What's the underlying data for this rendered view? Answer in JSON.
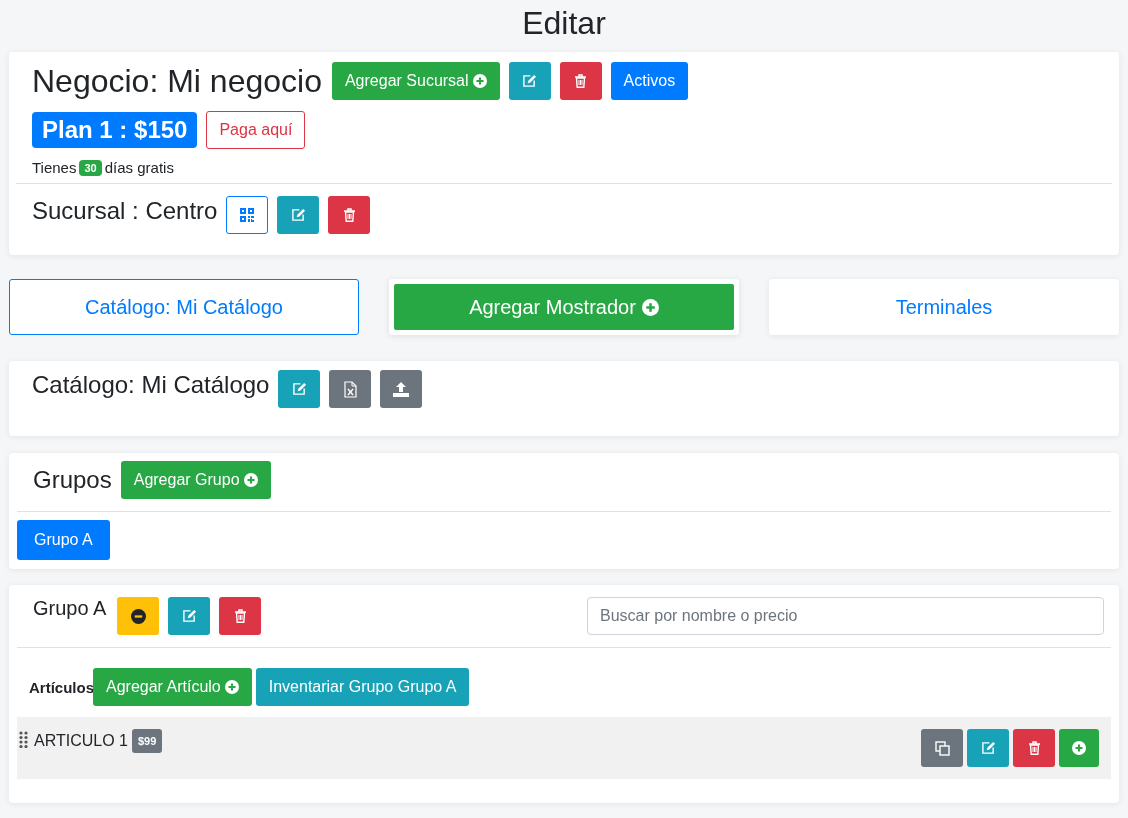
{
  "page_title": "Editar",
  "business": {
    "title": "Negocio: Mi negocio",
    "buttons": [
      {
        "kind": "add",
        "label": "Agregar Sucursal"
      },
      {
        "kind": "edit"
      },
      {
        "kind": "delete"
      },
      {
        "kind": "primary",
        "label": "Activos"
      }
    ],
    "plan": "Plan 1 : $150",
    "pay_button": {
      "kind": "outline-danger",
      "label": "Paga aquí"
    },
    "trial": {
      "before": "Tienes",
      "days": "30",
      "after": "días gratis"
    },
    "branch": {
      "title": "Sucursal : Centro",
      "buttons": [
        {
          "kind": "qr"
        },
        {
          "kind": "edit"
        },
        {
          "kind": "delete"
        }
      ]
    }
  },
  "nav": [
    {
      "kind": "outline",
      "label": "Catálogo: Mi Catálogo"
    },
    {
      "kind": "add",
      "label": "Agregar Mostrador"
    },
    {
      "kind": "plain",
      "label": "Terminales"
    }
  ],
  "catalog": {
    "title": "Catálogo: Mi Catálogo",
    "buttons": [
      {
        "kind": "edit"
      },
      {
        "kind": "excel"
      },
      {
        "kind": "upload"
      }
    ]
  },
  "groups": {
    "title": "Grupos",
    "add_button": {
      "kind": "add",
      "label": "Agregar Grupo"
    },
    "items": [
      {
        "kind": "primary",
        "label": "Grupo A"
      }
    ]
  },
  "group": {
    "title": "Grupo A",
    "buttons": [
      {
        "kind": "collapse"
      },
      {
        "kind": "edit"
      },
      {
        "kind": "delete"
      }
    ],
    "search": {
      "placeholder": "Buscar por nombre o precio"
    },
    "articles_label": "Artículos",
    "article_buttons": [
      {
        "kind": "add",
        "label": "Agregar Artículo"
      },
      {
        "kind": "info",
        "label": "Inventariar Grupo Grupo A"
      }
    ],
    "items": [
      {
        "name": "ARTICULO 1",
        "price": "$99",
        "buttons": [
          {
            "kind": "copy"
          },
          {
            "kind": "edit"
          },
          {
            "kind": "delete"
          },
          {
            "kind": "add"
          }
        ]
      }
    ]
  }
}
